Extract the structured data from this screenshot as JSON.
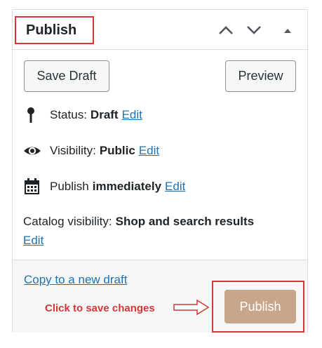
{
  "panel": {
    "title": "Publish",
    "header_icons": [
      "chevron-up-icon",
      "chevron-down-icon",
      "triangle-up-icon"
    ]
  },
  "actions": {
    "save_draft": "Save Draft",
    "preview": "Preview"
  },
  "status": {
    "label": "Status:",
    "value": "Draft",
    "edit": "Edit",
    "icon": "pin-icon"
  },
  "visibility": {
    "label": "Visibility:",
    "value": "Public",
    "edit": "Edit",
    "icon": "eye-icon"
  },
  "schedule": {
    "label": "Publish",
    "value": "immediately",
    "edit": "Edit",
    "icon": "calendar-icon"
  },
  "catalog": {
    "label": "Catalog visibility:",
    "value": "Shop and search results",
    "edit": "Edit"
  },
  "footer": {
    "copy_link": "Copy to a new draft",
    "hint": "Click to save changes",
    "publish": "Publish"
  },
  "colors": {
    "highlight": "#d63638",
    "publish_button": "#c8a68b",
    "link": "#2271b1"
  }
}
